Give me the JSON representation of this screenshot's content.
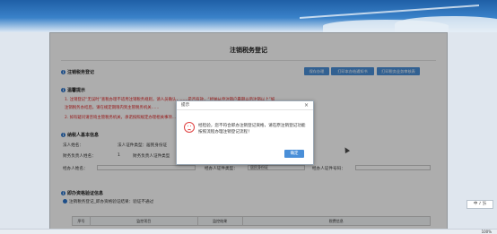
{
  "page": {
    "title": "注销税务登记",
    "sections": {
      "s1": "注销税务登记",
      "s2": "温馨提示",
      "s3": "纳税人基本信息",
      "s4": "即办资格验证信息"
    },
    "buttons": {
      "save": "保存办理",
      "print_notice": "打印本办结通知书",
      "print_review": "打印税务业务审核表"
    },
    "notices": [
      "1. 注销登记“无误时”查税办理不适用注销税务规则，请人员确认，……是否有效，“经纳从申注销户最期以后注销以上”如",
      "注销税务办结后，请在规定期限内到主管税务机关……",
      "2. 如有疑问请咨询主管税务机关，承诺按照规定办理相关事项……"
    ],
    "info": {
      "taxpayer_name_label": "法人姓名：",
      "legal_id_type_label": "法人证件类型：居民身份证",
      "finance_person_label": "财务负责人姓名：",
      "finance_person_value": "1",
      "finance_id_type_label": "财务负责人证件类型",
      "agent_name_label": "经办人姓名：",
      "agent_id_type_label": "经办人证件类型：",
      "agent_id_type_value": "居民身份证",
      "agent_id_no_label": "经办人证件号码："
    },
    "verify_line": "注销税务登记_即办资格验证结果：验证不通过",
    "table_headers": [
      "序号",
      "监控项目",
      "监控结果",
      "税费信息"
    ]
  },
  "dialog": {
    "title": "提示",
    "close": "×",
    "message": "经检验，您不符合即办注销登记资格，请在原注销登记功能按照流程办理注销登记流程！",
    "ok": "确定"
  },
  "side_tool": {
    "label": "中 ♪ 卐"
  },
  "statusbar": {
    "zoom": "100%"
  }
}
